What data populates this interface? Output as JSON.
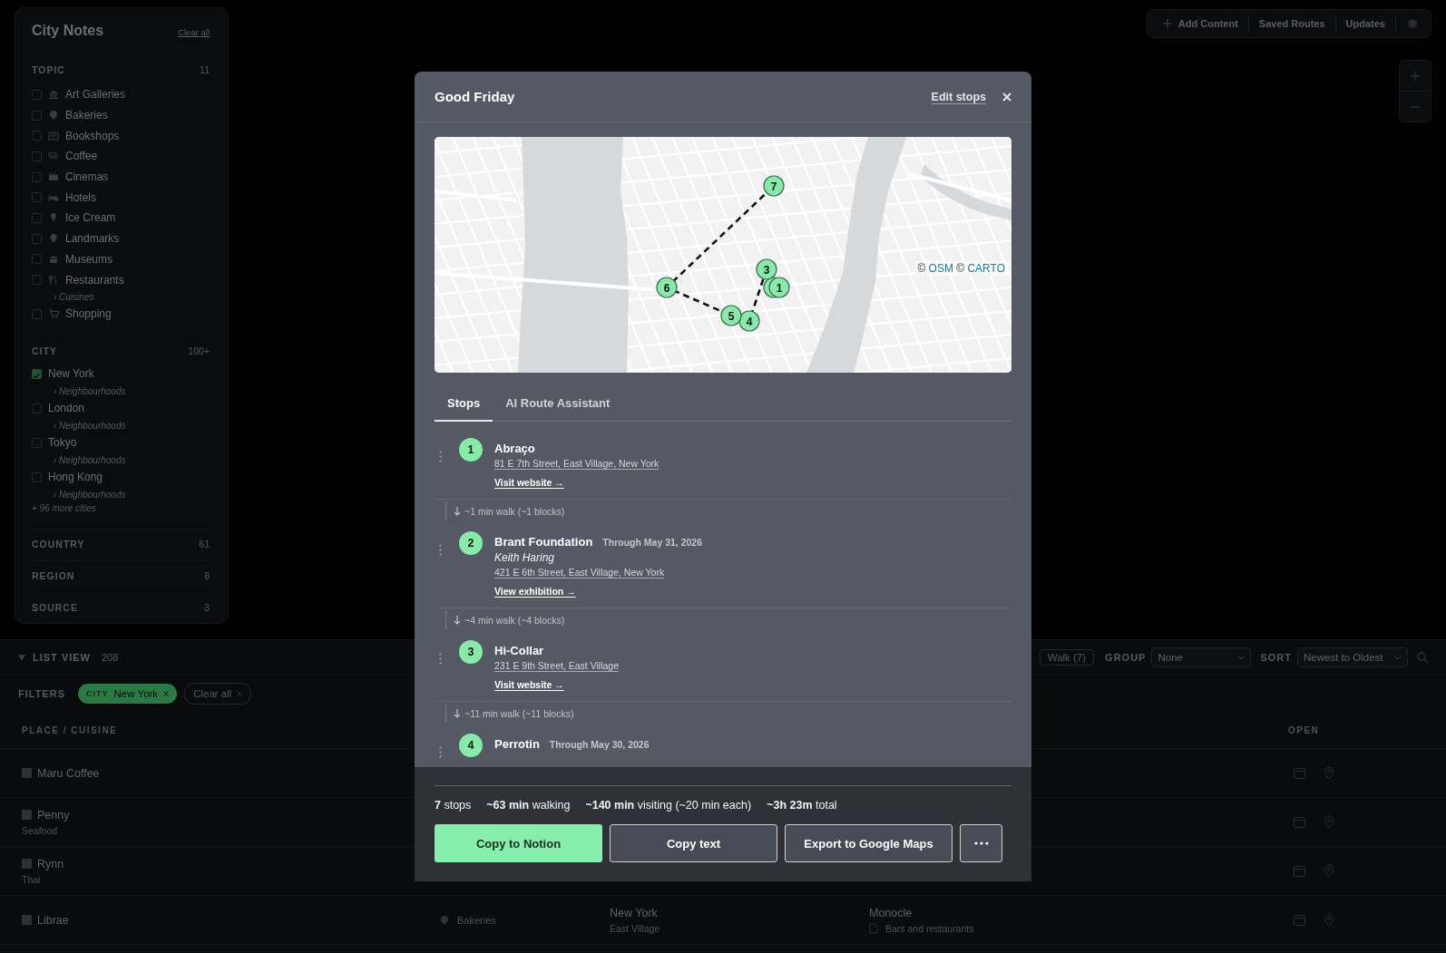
{
  "sidebar": {
    "title": "City Notes",
    "clear": "Clear all",
    "sections": [
      {
        "kind": "topic",
        "heading": "TOPIC",
        "count": "11",
        "items": [
          {
            "label": "Art Galleries",
            "checked": false
          },
          {
            "label": "Bakeries",
            "checked": false
          },
          {
            "label": "Bookshops",
            "checked": false
          },
          {
            "label": "Coffee",
            "checked": false
          },
          {
            "label": "Cinemas",
            "checked": false
          },
          {
            "label": "Hotels",
            "checked": false
          },
          {
            "label": "Ice Cream",
            "checked": false
          },
          {
            "label": "Landmarks",
            "checked": false
          },
          {
            "label": "Museums",
            "checked": false
          },
          {
            "label": "Restaurants",
            "checked": false,
            "sub": "› Cuisines"
          },
          {
            "label": "Shopping",
            "checked": false
          }
        ]
      },
      {
        "kind": "city",
        "heading": "CITY",
        "count": "100+",
        "more": "+ 96 more cities",
        "items": [
          {
            "label": "New York",
            "checked": true,
            "sub": "› Neighbourhoods"
          },
          {
            "label": "London",
            "checked": false,
            "sub": "› Neighbourhoods"
          },
          {
            "label": "Tokyo",
            "checked": false,
            "sub": "› Neighbourhoods"
          },
          {
            "label": "Hong Kong",
            "checked": false,
            "sub": "› Neighbourhoods"
          }
        ]
      },
      {
        "kind": "plain",
        "heading": "COUNTRY",
        "count": "61"
      },
      {
        "kind": "plain",
        "heading": "REGION",
        "count": "8"
      },
      {
        "kind": "plain",
        "heading": "SOURCE",
        "count": "3"
      }
    ]
  },
  "toolbar": {
    "actions": [
      {
        "kind": "add",
        "label": "Add Content"
      },
      {
        "kind": "plain",
        "label": "Saved Routes"
      },
      {
        "kind": "plain",
        "label": "Updates"
      }
    ]
  },
  "list": {
    "title": "LIST VIEW",
    "count": "208",
    "walk_button": "Walk (7)",
    "group": {
      "label": "GROUP",
      "value": "None"
    },
    "sort": {
      "label": "SORT",
      "value": "Newest to Oldest"
    },
    "filters": {
      "label": "FILTERS",
      "chips": [
        {
          "kind": "city",
          "key": "CITY",
          "value": "New York"
        },
        {
          "kind": "clear",
          "value": "Clear all"
        }
      ]
    },
    "columns": {
      "place": "PLACE / CUISINE",
      "open": "OPEN"
    },
    "rows": [
      {
        "name": "Maru Coffee",
        "checked": false
      },
      {
        "name": "Penny",
        "cuisine": "Seafood",
        "checked": false
      },
      {
        "name": "Rynn",
        "cuisine": "Thai",
        "checked": false
      },
      {
        "name": "Librae",
        "checked": false,
        "topic": "Bakeries",
        "city": "New York",
        "neighbourhood": "East Village",
        "source": "Monocle",
        "source_section": "Bars and restaurants"
      }
    ]
  },
  "modal": {
    "title": "Good Friday",
    "edit": "Edit stops",
    "map": {
      "markers": [
        "1",
        "3",
        "4",
        "5",
        "6",
        "7"
      ],
      "attribution": {
        "prefix": "©",
        "links": [
          "OSM",
          "CARTO"
        ]
      }
    },
    "tabs": [
      {
        "label": "Stops",
        "selected": true
      },
      {
        "label": "AI Route Assistant",
        "selected": false
      }
    ],
    "itinerary": [
      {
        "kind": "stop",
        "number": "1",
        "name": "Abraço",
        "address": "81 E 7th Street, East Village, New York",
        "link": "Visit website →"
      },
      {
        "kind": "walk",
        "text": "~1 min walk (~1 blocks)"
      },
      {
        "kind": "stop",
        "number": "2",
        "name": "Brant Foundation",
        "date": "Through May 31, 2026",
        "subtitle": "Keith Haring",
        "address": "421 E 6th Street, East Village, New York",
        "link": "View exhibition →"
      },
      {
        "kind": "walk",
        "text": "~4 min walk (~4 blocks)"
      },
      {
        "kind": "stop",
        "number": "3",
        "name": "Hi-Collar",
        "address": "231 E 9th Street, East Village",
        "link": "Visit website →"
      },
      {
        "kind": "walk",
        "text": "~11 min walk (~11 blocks)"
      },
      {
        "kind": "stop",
        "number": "4",
        "name": "Perrotin",
        "date": "Through May 30, 2026"
      }
    ],
    "summary": [
      "**7** stops",
      "**~63 min** walking",
      "**~140 min** visiting (~20 min each)",
      "**~3h 23m** total"
    ],
    "actions": [
      {
        "kind": "primary",
        "label": "Copy to Notion"
      },
      {
        "kind": "secondary",
        "label": "Copy text"
      },
      {
        "kind": "secondary",
        "label": "Export to Google Maps"
      },
      {
        "kind": "more"
      }
    ]
  }
}
